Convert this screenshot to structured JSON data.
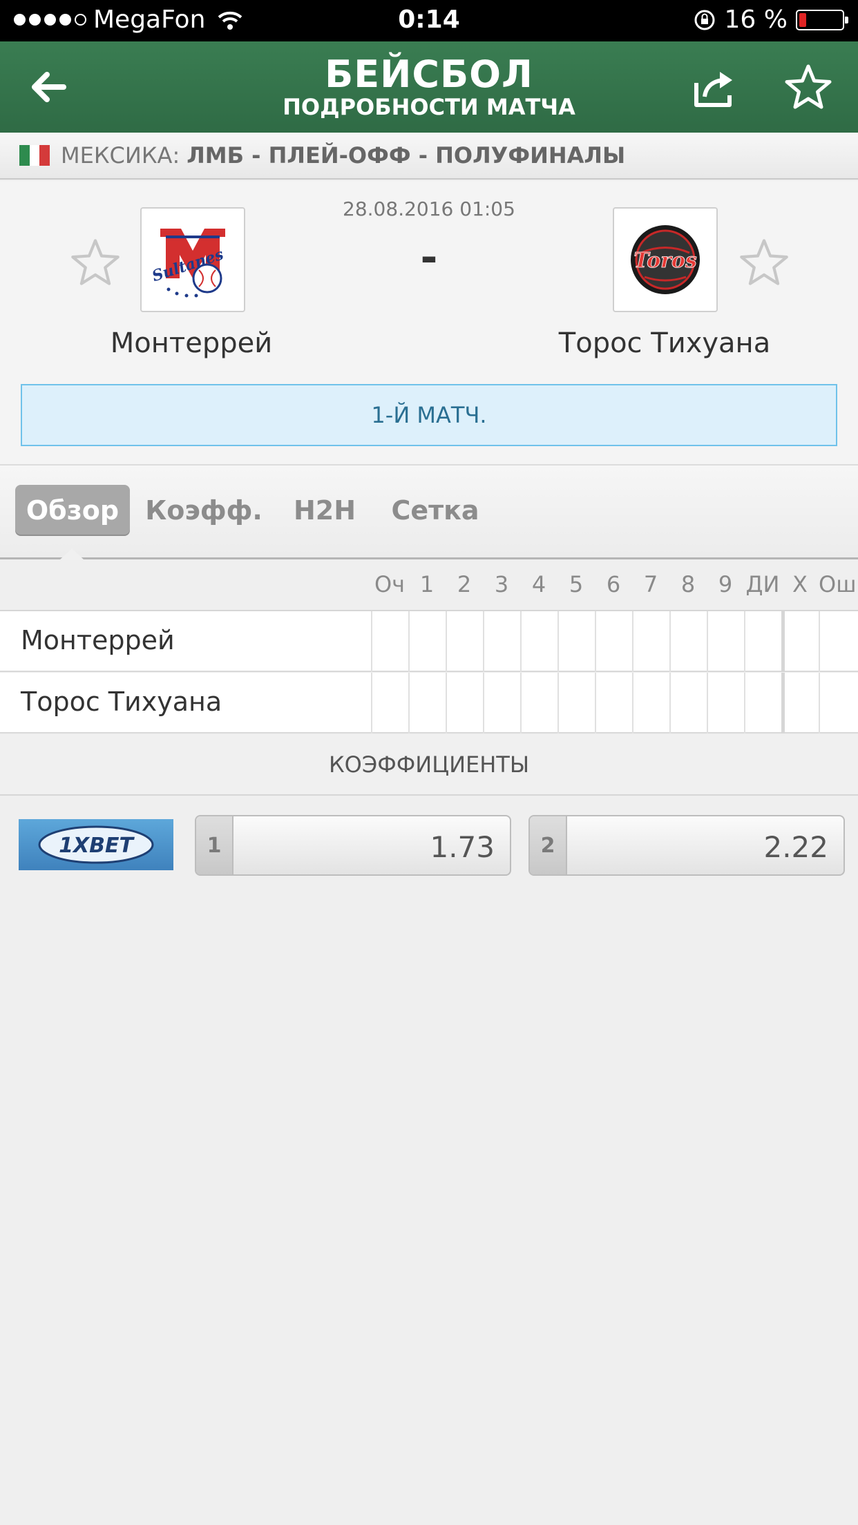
{
  "status_bar": {
    "carrier": "MegaFon",
    "time": "0:14",
    "battery": "16 %",
    "battery_level": 0.16,
    "signal_bars": 4
  },
  "header": {
    "title": "БЕЙСБОЛ",
    "subtitle": "ПОДРОБНОСТИ МАТЧА"
  },
  "league": {
    "country": "МЕКСИКА:",
    "name": "ЛМБ - ПЛЕЙ-ОФФ - ПОЛУФИНАЛЫ"
  },
  "match": {
    "datetime": "28.08.2016 01:05",
    "score": "-",
    "home_team": "Монтеррей",
    "away_team": "Торос Тихуана",
    "home_logo_text": "Sultanes",
    "away_logo_text": "Toros",
    "round_info": "1-Й МАТЧ."
  },
  "tabs": [
    "Обзор",
    "Коэфф.",
    "H2H",
    "Сетка"
  ],
  "scoreboard": {
    "columns": [
      "Оч",
      "1",
      "2",
      "3",
      "4",
      "5",
      "6",
      "7",
      "8",
      "9",
      "ДИ",
      "Х",
      "Ош"
    ],
    "rows": [
      "Монтеррей",
      "Торос Тихуана"
    ]
  },
  "odds": {
    "title": "КОЭФФИЦИЕНТЫ",
    "bookmaker": "1XBET",
    "options": [
      {
        "label": "1",
        "value": "1.73"
      },
      {
        "label": "2",
        "value": "2.22"
      }
    ]
  },
  "colors": {
    "header_green": "#3a7d52",
    "round_bg": "#ddf0fb",
    "round_border": "#6fc2ea",
    "battery_red": "#e02424"
  }
}
